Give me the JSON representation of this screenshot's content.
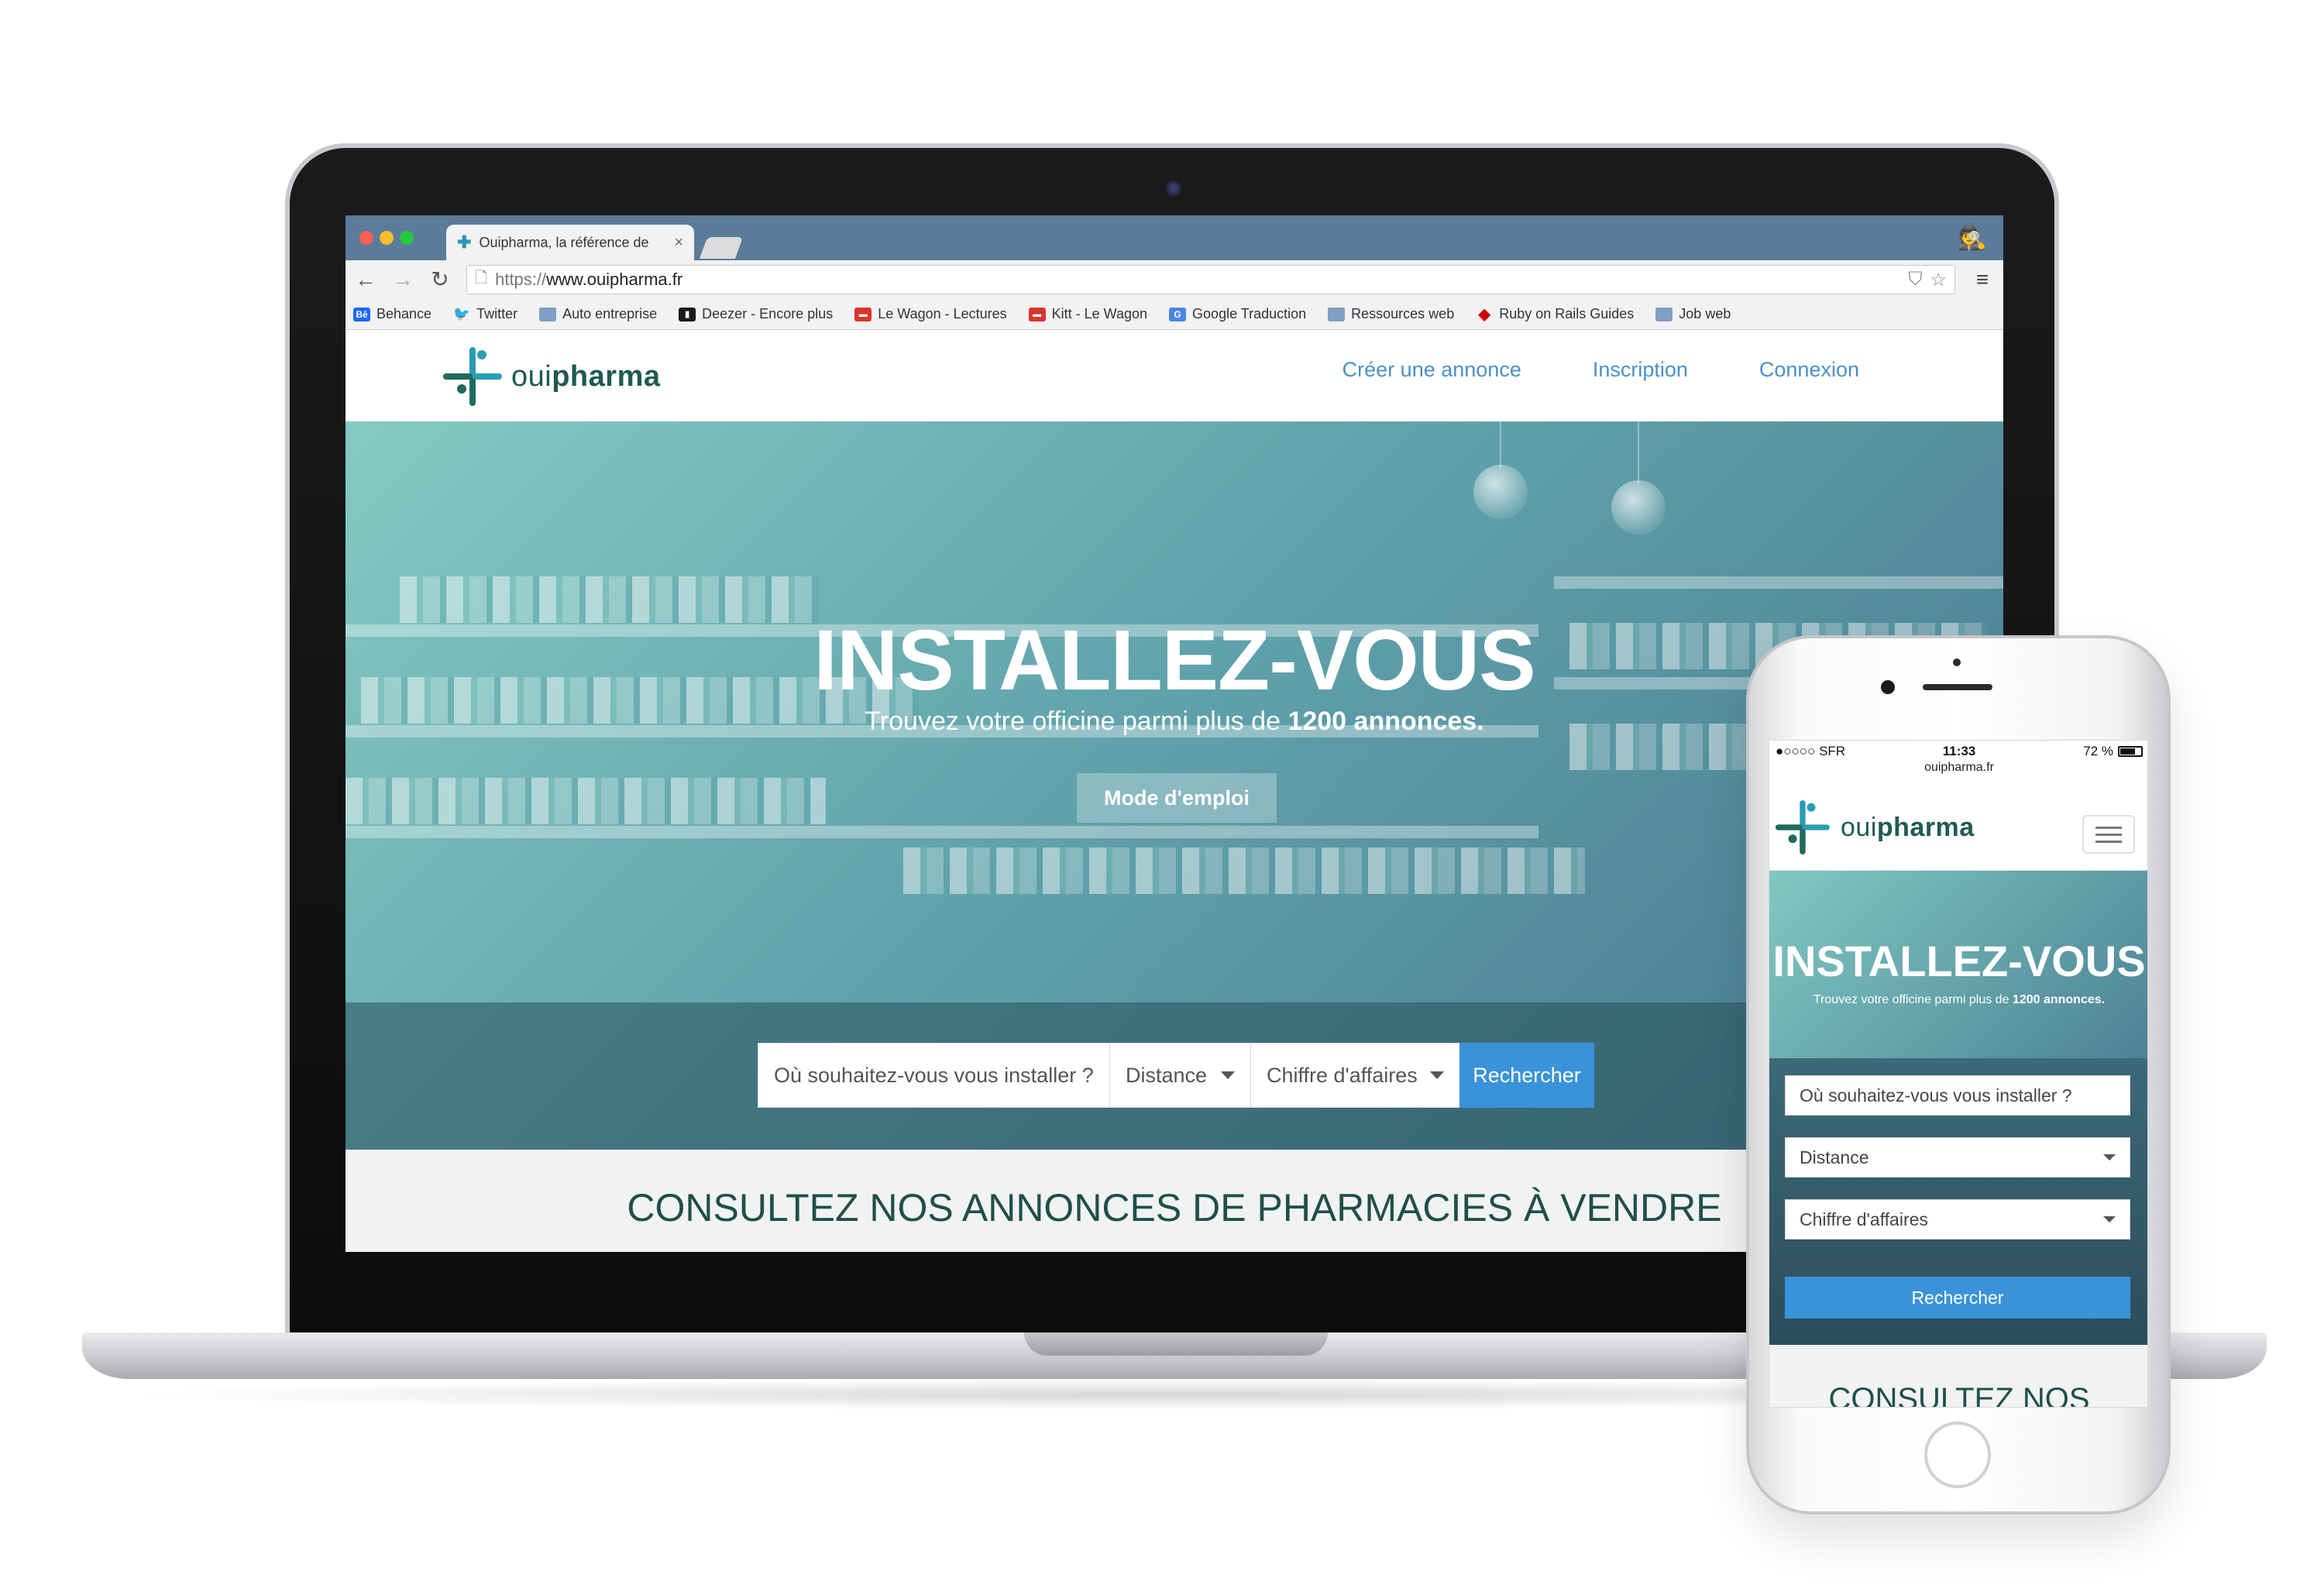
{
  "browser": {
    "tab_title": "Ouipharma, la référence de",
    "tab_close": "×",
    "url_scheme": "https://",
    "url_host": "www.ouipharma.fr",
    "bookmarks": [
      {
        "label": "Behance",
        "icon": "behance-icon"
      },
      {
        "label": "Twitter",
        "icon": "twitter-icon"
      },
      {
        "label": "Auto entreprise",
        "icon": "folder-icon"
      },
      {
        "label": "Deezer - Encore plus",
        "icon": "deezer-icon"
      },
      {
        "label": "Le Wagon - Lectures",
        "icon": "lewagon-icon"
      },
      {
        "label": "Kitt - Le Wagon",
        "icon": "kitt-icon"
      },
      {
        "label": "Google Traduction",
        "icon": "google-translate-icon"
      },
      {
        "label": "Ressources web",
        "icon": "folder-icon"
      },
      {
        "label": "Ruby on Rails Guides",
        "icon": "ruby-icon"
      },
      {
        "label": "Job web",
        "icon": "folder-icon"
      }
    ]
  },
  "site": {
    "logo_prefix": "oui",
    "logo_suffix": "pharma",
    "nav": [
      "Créer une annonce",
      "Inscription",
      "Connexion"
    ],
    "hero_title": "INSTALLEZ-VOUS",
    "hero_sub_prefix": "Trouvez votre officine parmi plus de ",
    "hero_sub_bold": "1200 annonces.",
    "mode_emploi": "Mode d'emploi",
    "search_where_placeholder": "Où souhaitez-vous vous installer ?",
    "search_distance": "Distance",
    "search_ca": "Chiffre d'affaires",
    "search_submit": "Rechercher",
    "listings_title": "CONSULTEZ NOS ANNONCES DE PHARMACIES À VENDRE"
  },
  "phone": {
    "carrier": "●○○○○ SFR",
    "time": "11:33",
    "battery": "72 %",
    "battery_level": 0.72,
    "url": "ouipharma.fr",
    "listings_title": "CONSULTEZ NOS"
  },
  "colors": {
    "accent_blue": "#3a93d8",
    "nav_blue": "#4a90c6",
    "logo_teal": "#2a9db5",
    "logo_green": "#1f6b5d",
    "title_green": "#1f4f49"
  }
}
